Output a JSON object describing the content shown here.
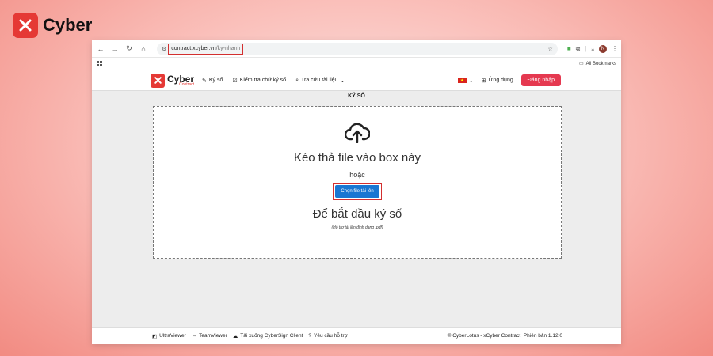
{
  "brand": {
    "name": "Cyber",
    "accent": "#e53935"
  },
  "browser": {
    "url_domain": "contract.xcyber.vn",
    "url_path": "/ky-nhanh",
    "bookmarks_label": "All Bookmarks",
    "avatar_initial": "N"
  },
  "app": {
    "logo_main": "Cyber",
    "logo_sub": "Contract",
    "nav": {
      "sign": "Ký số",
      "check": "Kiểm tra chữ ký số",
      "lookup": "Tra cứu tài liệu",
      "apps": "Ứng dụng",
      "login": "Đăng nhập"
    }
  },
  "main": {
    "heading": "KÝ SỐ",
    "drop_title": "Kéo thả file vào box này",
    "or": "hoặc",
    "choose_button": "Chọn file tải lên",
    "start": "Để bắt đầu ký số",
    "support": "(Hỗ trợ tải lên định dạng .pdf)"
  },
  "footer": {
    "ultraviewer": "UltraViewer",
    "teamviewer": "TeamViewer",
    "download": "Tải xuống CyberSign Client",
    "support": "Yêu cầu hỗ trợ",
    "copyright": "© CyberLotus - xCyber Contract",
    "version": "Phiên bản 1.12.0"
  }
}
